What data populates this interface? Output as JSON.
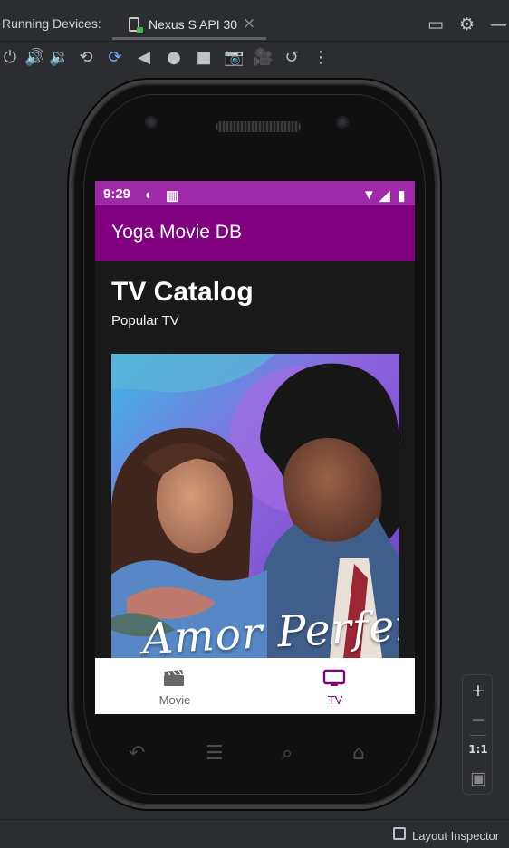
{
  "ide": {
    "title": "Running Devices:",
    "tab": "Nexus S API 30",
    "close_symbol": "×",
    "footer_label": "Layout Inspector"
  },
  "app": {
    "time": "9:29",
    "title": "Yoga Movie DB",
    "catalog_title": "TV Catalog",
    "catalog_subtitle": "Popular TV",
    "poster_title": "Amor Perfeit",
    "nav": {
      "movie": "Movie",
      "tv": "TV"
    }
  },
  "zoom": {
    "plus": "+",
    "minus": "−",
    "actual": "1:1"
  },
  "colors": {
    "status_bar": "#9d28a8",
    "app_bar": "#800080",
    "accent": "#800080",
    "ide_background": "#2b2d30"
  },
  "icons": {
    "ide_tab": "device-icon",
    "window": "window-icon",
    "settings": "gear-icon",
    "minimize": "minimize-icon",
    "power": "power-icon",
    "volume_up": "volume-up-icon",
    "volume_down": "volume-down-icon",
    "rotate_left": "rotate-left-icon",
    "rotate_right": "rotate-right-icon",
    "back": "back-icon",
    "home": "home-icon",
    "overview": "overview-icon",
    "camera": "camera-icon",
    "video": "video-icon",
    "reset": "reset-icon",
    "more": "more-icon",
    "movie": "clapperboard-icon",
    "tv": "tv-icon",
    "layout_inspector": "layout-inspector-icon"
  }
}
